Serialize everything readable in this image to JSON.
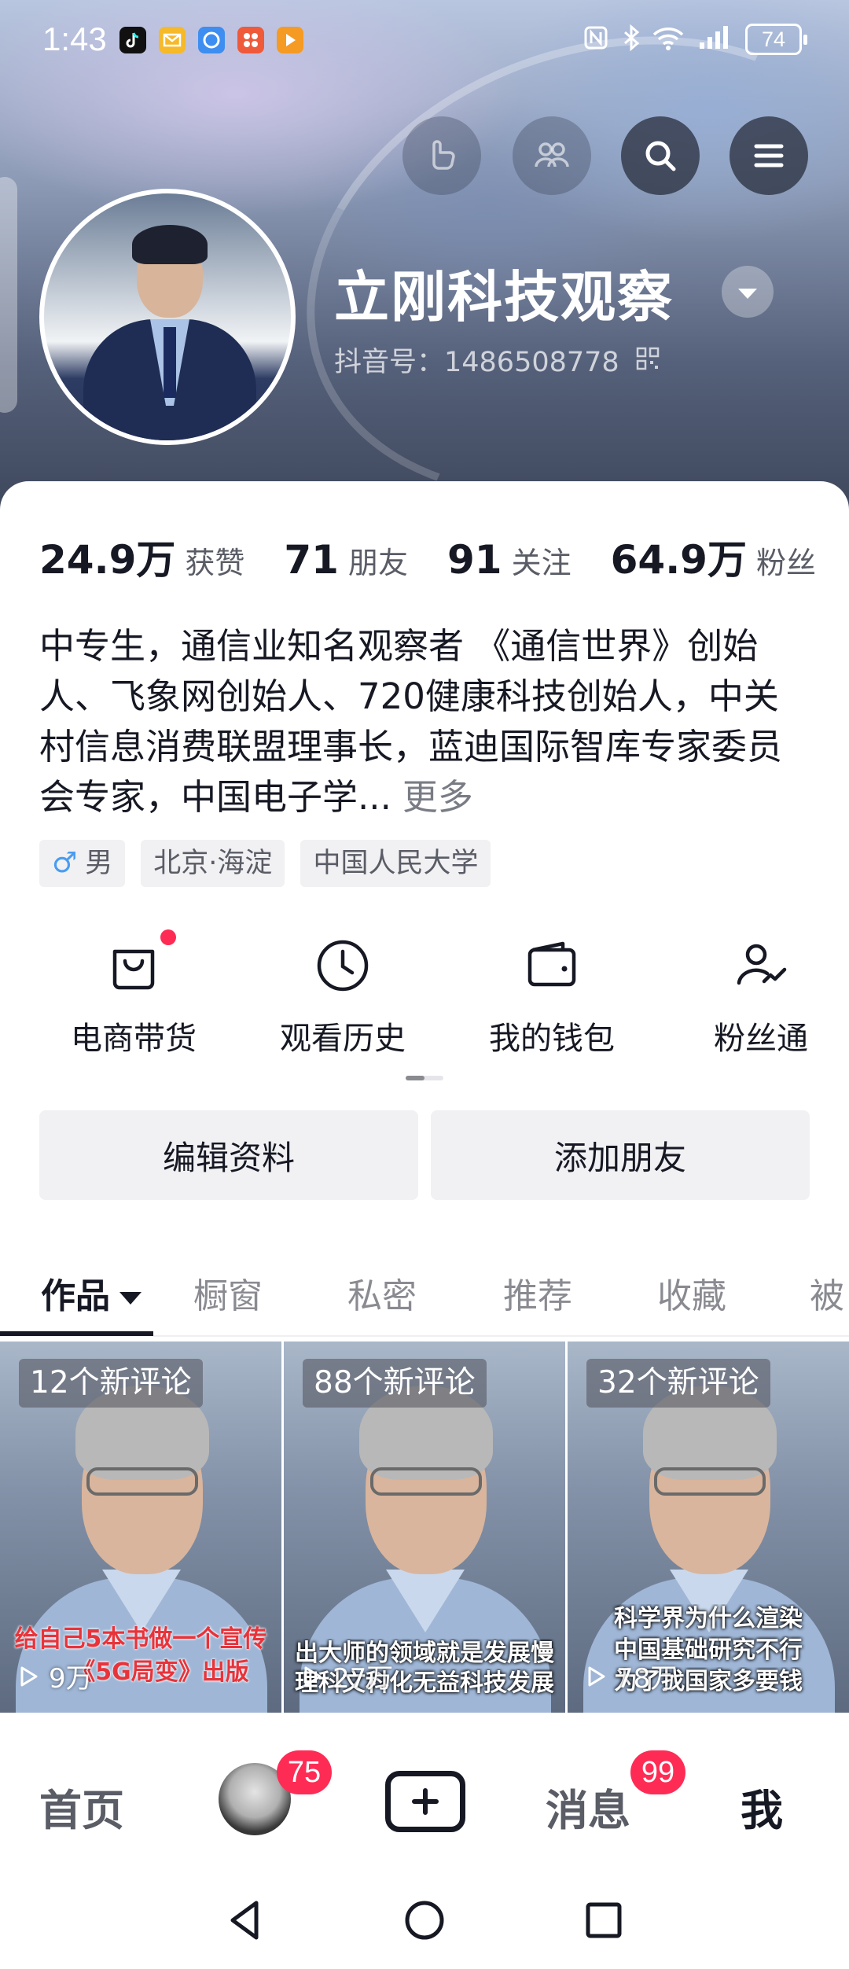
{
  "status_bar": {
    "time": "1:43",
    "battery": "74",
    "app_icons": [
      "douyin-icon",
      "mail-icon",
      "browser-icon",
      "app-market-icon",
      "video-player-icon"
    ],
    "system_icons": [
      "nfc-icon",
      "bluetooth-icon",
      "wifi-icon",
      "signal-icon"
    ]
  },
  "header": {
    "buttons": [
      "gesture-icon",
      "friends-icon",
      "search-icon",
      "menu-icon"
    ]
  },
  "profile": {
    "name": "立刚科技观察",
    "douyin_id": "抖音号：1486508778"
  },
  "stats": [
    {
      "value": "24.9万",
      "label": "获赞"
    },
    {
      "value": "71",
      "label": "朋友"
    },
    {
      "value": "91",
      "label": "关注"
    },
    {
      "value": "64.9万",
      "label": "粉丝"
    }
  ],
  "bio": {
    "text": "中专生，通信业知名观察者 《通信世界》创始人、飞象网创始人、720健康科技创始人，中关村信息消费联盟理事长，蓝迪国际智库专家委员会专家，中国电子学...",
    "more": "更多"
  },
  "tags": {
    "gender_symbol": "♂",
    "gender": "男",
    "location": "北京·海淀",
    "school": "中国人民大学"
  },
  "tools": [
    {
      "label": "电商带货",
      "icon": "shopping-bag-icon"
    },
    {
      "label": "观看历史",
      "icon": "clock-icon"
    },
    {
      "label": "我的钱包",
      "icon": "wallet-icon"
    },
    {
      "label": "粉丝通",
      "icon": "fans-growth-icon"
    }
  ],
  "actions": {
    "edit": "编辑资料",
    "add_friend": "添加朋友"
  },
  "tabs": [
    "作品",
    "橱窗",
    "私密",
    "推荐",
    "收藏",
    "被"
  ],
  "videos": [
    {
      "badge": "12个新评论",
      "caption": "给自己5本书做一个宣传",
      "caption2": "《5G局变》出版",
      "plays": "9万",
      "style": "red"
    },
    {
      "badge": "88个新评论",
      "caption": "出大师的领域就是发展慢",
      "caption2": "理科文科化无益科技发展",
      "plays": "27万",
      "style": "white"
    },
    {
      "badge": "32个新评论",
      "caption": "科学界为什么渲染",
      "caption2": "中国基础研究不行",
      "caption3": "为了找国家多要钱",
      "plays": "78万",
      "style": "white"
    }
  ],
  "bottom_nav": {
    "home": "首页",
    "friends_badge": "75",
    "messages": "消息",
    "messages_badge": "99",
    "me": "我"
  },
  "colors": {
    "accent": "#fe2c55",
    "text_primary": "#161823",
    "text_secondary": "#5a5c66",
    "button_bg": "#f1f1f3",
    "male_blue": "#4a9cf0"
  }
}
